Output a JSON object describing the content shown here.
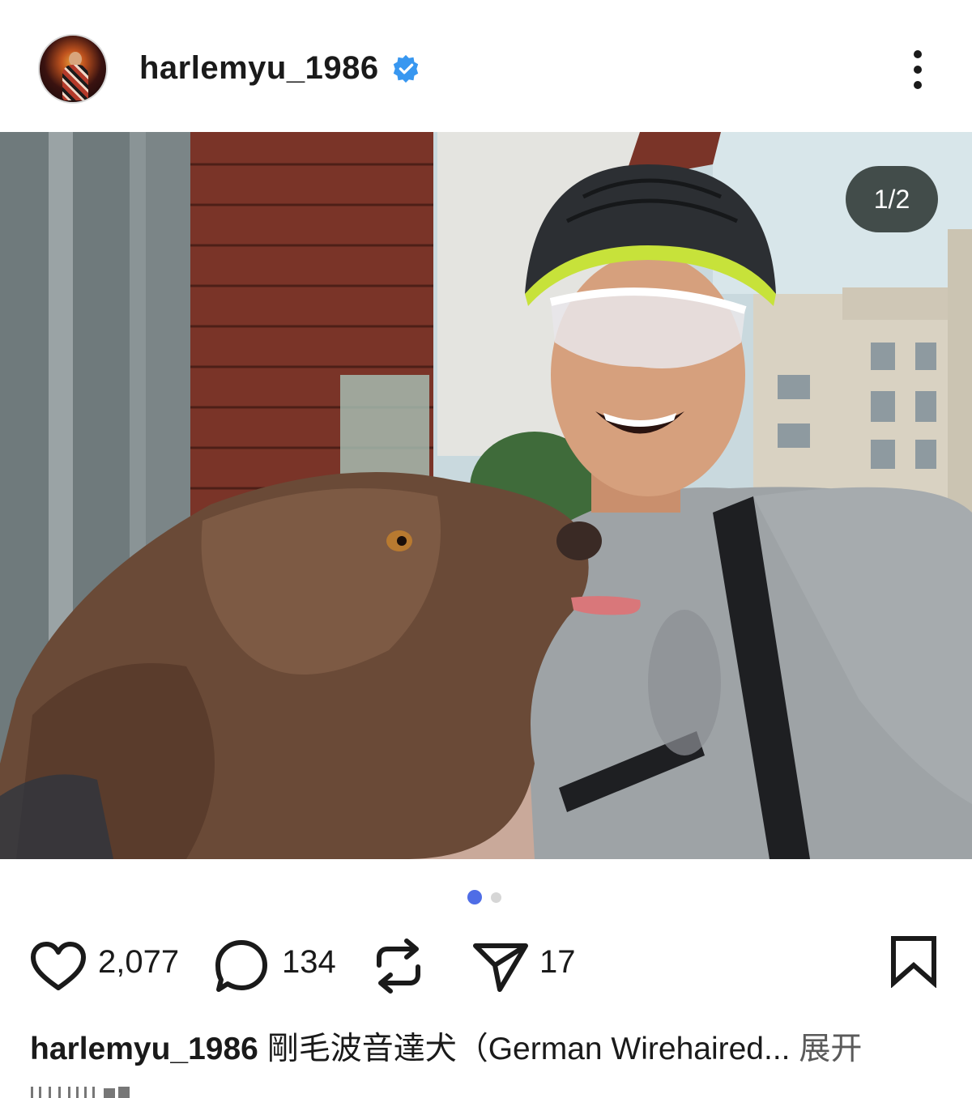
{
  "post": {
    "username": "harlemyu_1986",
    "verified": true,
    "avatar_icon": "profile-avatar",
    "more_icon": "more-vertical-icon"
  },
  "media": {
    "counter": "1/2",
    "current_slide": 1,
    "total_slides": 2,
    "description_icon": "selfie-photo-man-helmet-dog"
  },
  "actions": {
    "likes": "2,077",
    "comments": "134",
    "shares": "17",
    "like_icon": "heart-outline-icon",
    "comment_icon": "comment-bubble-icon",
    "repost_icon": "repost-icon",
    "share_icon": "send-icon",
    "save_icon": "bookmark-icon"
  },
  "caption": {
    "username": "harlemyu_1986",
    "text": "剛毛波音達犬（German Wirehaired...",
    "more_label": "展开"
  },
  "colors": {
    "accent": "#4f6de6",
    "verified": "#3897f0"
  }
}
